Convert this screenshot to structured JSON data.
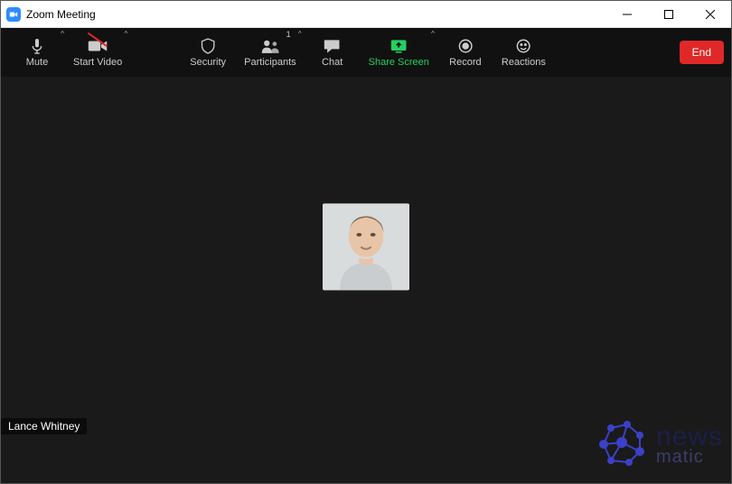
{
  "window": {
    "title": "Zoom Meeting"
  },
  "participant": {
    "name": "Lance Whitney"
  },
  "toolbar": {
    "mute": "Mute",
    "start_video": "Start Video",
    "security": "Security",
    "participants": "Participants",
    "participants_count": "1",
    "chat": "Chat",
    "share_screen": "Share Screen",
    "record": "Record",
    "reactions": "Reactions",
    "end": "End"
  },
  "watermark": {
    "line1": "news",
    "line2": "matic"
  }
}
